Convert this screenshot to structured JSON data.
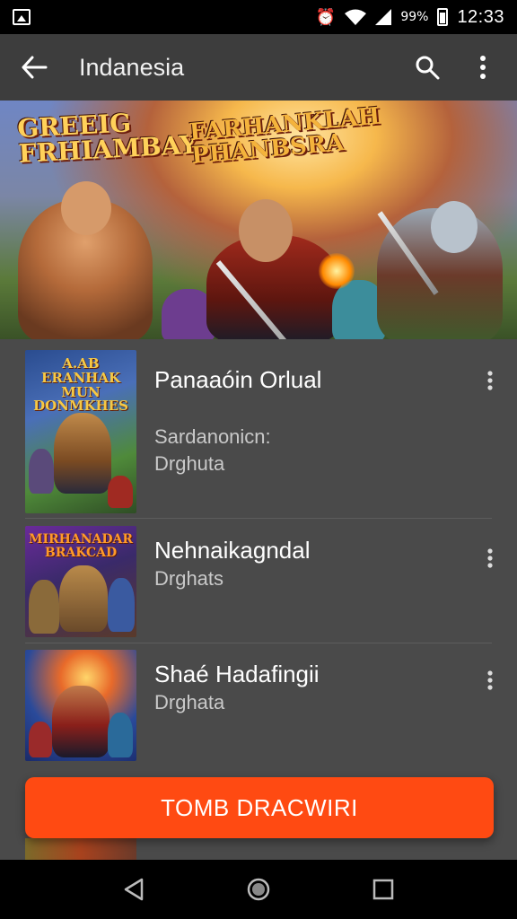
{
  "status_bar": {
    "icons": [
      "photo-icon",
      "alarm-icon",
      "wifi-icon",
      "signal-icon",
      "battery-icon"
    ],
    "battery_text": "99%",
    "time": "12:33"
  },
  "app_bar": {
    "title": "Indanesia",
    "icons": [
      "back-arrow-icon",
      "search-icon",
      "more-vert-icon"
    ]
  },
  "hero": {
    "title_left": "GREEIG FRHIAMBAY",
    "title_right": "FARHANKLAH PHANBSRA"
  },
  "list": {
    "items": [
      {
        "thumb_text": "A.AB ERANHAK MUN DONMKHES",
        "title": "Panaaóin Orlual",
        "subtitle_1": "Sardanonicn:",
        "subtitle_2": "Drghuta"
      },
      {
        "thumb_text": "MIRHANADAR BRAKCAD",
        "title": "Nehnaikagndal",
        "subtitle_1": "Drghats"
      },
      {
        "thumb_text": "",
        "title": "Shaé Hadafingii",
        "subtitle_1": "Drghata"
      }
    ]
  },
  "cta": {
    "label": "TOMB DRACWIRI"
  },
  "colors": {
    "accent": "#ff4a12",
    "app_bar": "#3d3d3d",
    "background": "#4a4a4a"
  },
  "nav_bar": {
    "icons": [
      "back-triangle-icon",
      "home-circle-icon",
      "recents-square-icon"
    ]
  }
}
